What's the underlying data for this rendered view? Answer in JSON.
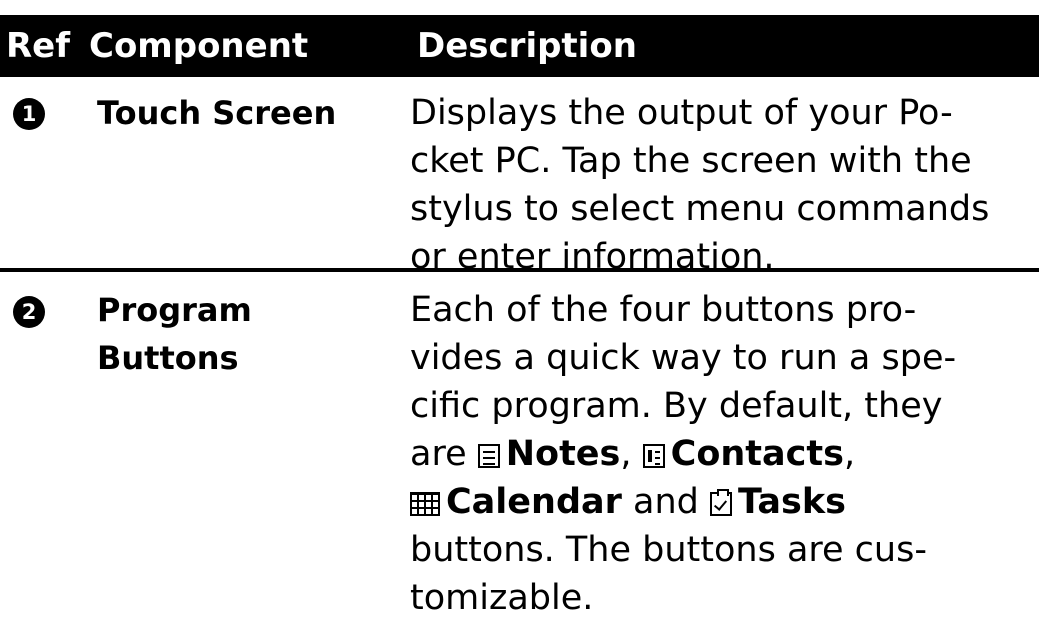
{
  "table": {
    "headers": {
      "ref": "Ref",
      "component": "Component",
      "description": "Description"
    },
    "rows": [
      {
        "ref": "1",
        "component_lines": [
          "Touch Screen"
        ],
        "description_lines": [
          "Displays the output of your Po-",
          "cket PC. Tap the screen with the",
          "stylus to select menu commands",
          "or enter information."
        ]
      },
      {
        "ref": "2",
        "component_lines": [
          "Program",
          "Buttons"
        ],
        "description_lines": [
          "Each of the four buttons pro-",
          "vides a quick way to run a spe-",
          "cific program. By default, they"
        ],
        "buttons_line": {
          "prefix": "are ",
          "notes": "Notes",
          "sep1": ", ",
          "contacts": "Contacts",
          "sep2": ","
        },
        "buttons_line2": {
          "calendar": "Calendar",
          "and": " and ",
          "tasks": "Tasks"
        },
        "closing_lines": [
          "buttons. The buttons are cus-",
          "tomizable."
        ]
      }
    ]
  },
  "icons": {
    "ref1": "circled-number-1",
    "ref2": "circled-number-2",
    "notes": "notes-icon",
    "contacts": "contacts-icon",
    "calendar": "calendar-icon",
    "tasks": "tasks-icon"
  },
  "colors": {
    "header_background": "#000000",
    "header_text": "#ffffff",
    "body_text": "#000000",
    "divider": "#000000"
  }
}
